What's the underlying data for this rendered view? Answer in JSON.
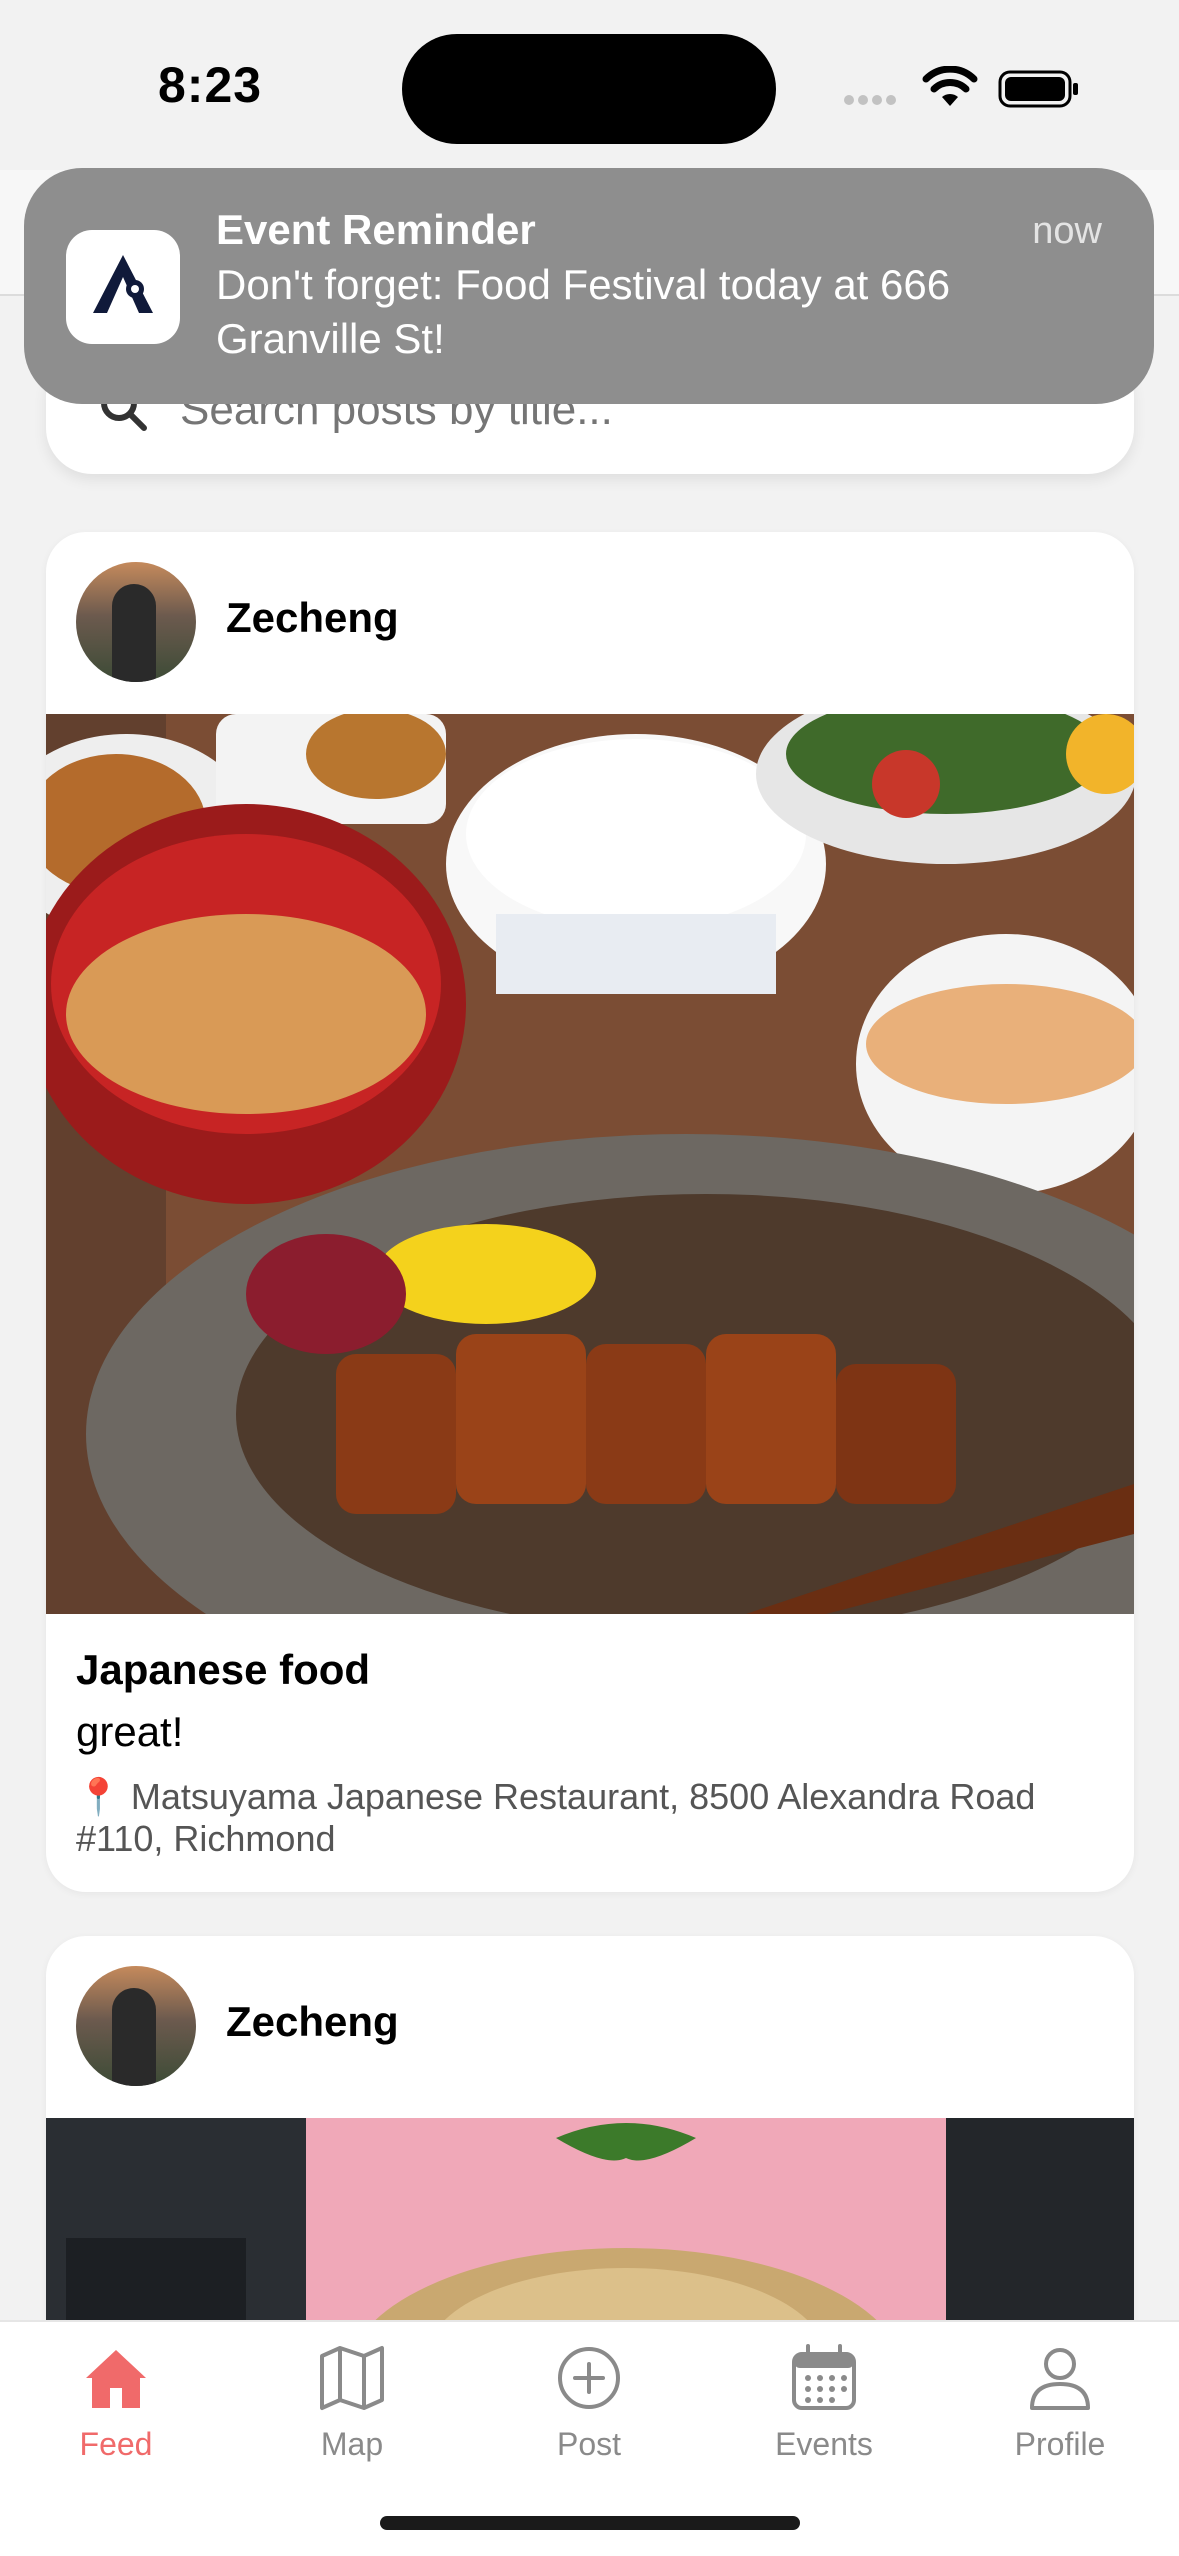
{
  "status_bar": {
    "time": "8:23"
  },
  "search": {
    "placeholder": "Search posts by title..."
  },
  "notification": {
    "title": "Event Reminder",
    "time": "now",
    "body": "Don't forget: Food Festival today at 666 Granville St!"
  },
  "posts": [
    {
      "username": "Zecheng",
      "title": "Japanese food",
      "body": "great!",
      "location": "📍 Matsuyama Japanese Restaurant, 8500 Alexandra Road #110, Richmond"
    },
    {
      "username": "Zecheng"
    }
  ],
  "tabs": [
    {
      "label": "Feed",
      "icon": "home-icon",
      "active": true
    },
    {
      "label": "Map",
      "icon": "map-icon",
      "active": false
    },
    {
      "label": "Post",
      "icon": "plus-circle-icon",
      "active": false
    },
    {
      "label": "Events",
      "icon": "calendar-icon",
      "active": false
    },
    {
      "label": "Profile",
      "icon": "person-icon",
      "active": false
    }
  ],
  "colors": {
    "accent": "#f06a6a",
    "tab_inactive": "#8a8a8a",
    "notification_bg": "#8e8e8e"
  }
}
